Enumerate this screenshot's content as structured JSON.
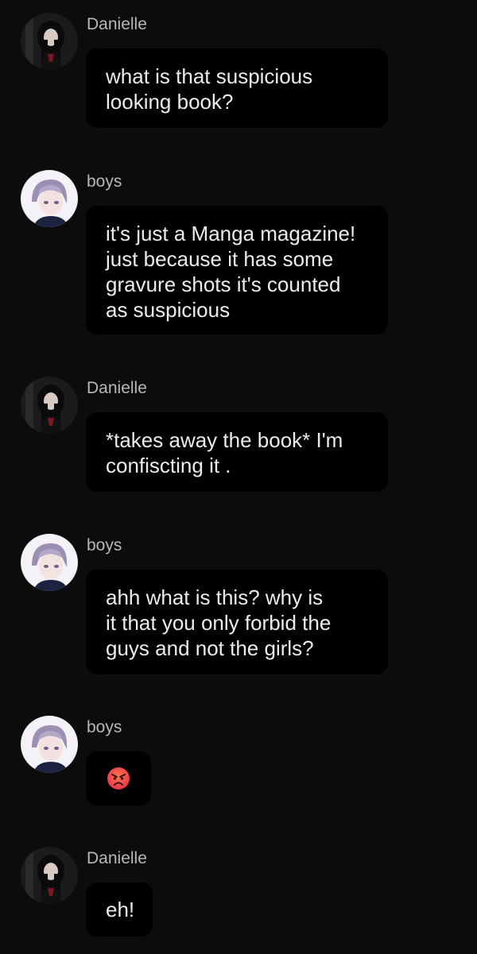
{
  "messages": [
    {
      "sender": "Danielle",
      "avatar": "danielle-avatar",
      "text": "what is that suspicious\nlooking book?"
    },
    {
      "sender": "boys",
      "avatar": "boys-avatar",
      "text": "it's just a Manga magazine!\njust because it has some\ngravure shots it's counted\nas suspicious"
    },
    {
      "sender": "Danielle",
      "avatar": "danielle-avatar",
      "text": "*takes away the book* I'm\nconfiscting it ."
    },
    {
      "sender": "boys",
      "avatar": "boys-avatar",
      "text": "ahh what is this? why is\nit that you only forbid the\nguys and not the girls?"
    },
    {
      "sender": "boys",
      "avatar": "boys-avatar",
      "emoji": "angry-face-emoji"
    },
    {
      "sender": "Danielle",
      "avatar": "danielle-avatar",
      "text": "eh!"
    }
  ],
  "colors": {
    "background": "#0c0c0c",
    "bubble": "#000000",
    "sender_name": "#b8b8b8",
    "message_text": "#ececec"
  }
}
